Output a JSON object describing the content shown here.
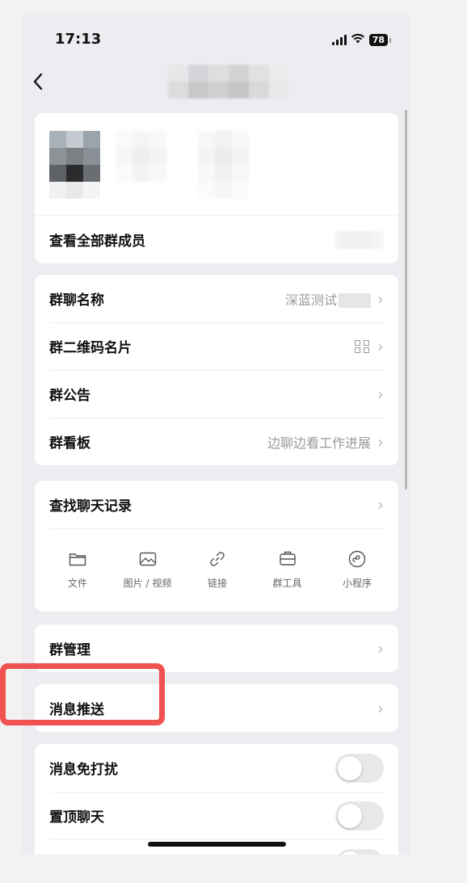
{
  "status_bar": {
    "time": "17:13",
    "battery": "78"
  },
  "members": {
    "view_all_label": "查看全部群成员"
  },
  "settings_group_1": [
    {
      "label": "群聊名称",
      "value": "深蓝测试"
    },
    {
      "label": "群二维码名片",
      "value": ""
    },
    {
      "label": "群公告",
      "value": ""
    },
    {
      "label": "群看板",
      "value": "边聊边看工作进展"
    }
  ],
  "chat_history": {
    "label": "查找聊天记录",
    "tools": [
      {
        "label": "文件",
        "icon": "folder-icon"
      },
      {
        "label": "图片 / 视频",
        "icon": "image-icon"
      },
      {
        "label": "链接",
        "icon": "link-icon"
      },
      {
        "label": "群工具",
        "icon": "toolbox-icon"
      },
      {
        "label": "小程序",
        "icon": "mini-program-icon"
      }
    ]
  },
  "group_manage": {
    "label": "群管理"
  },
  "message_push": {
    "label": "消息推送"
  },
  "toggles": [
    {
      "label": "消息免打扰",
      "on": false
    },
    {
      "label": "置顶聊天",
      "on": false
    }
  ],
  "colors": {
    "highlight": "#f0524f",
    "background": "#ededf1"
  }
}
